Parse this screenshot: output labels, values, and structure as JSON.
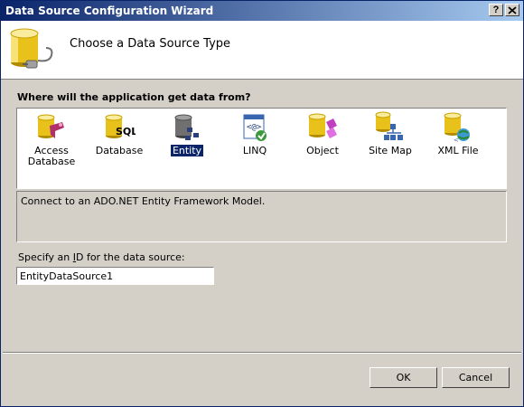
{
  "window": {
    "title": "Data Source Configuration Wizard",
    "help_label": "?",
    "close_label": "X"
  },
  "header": {
    "title": "Choose a Data Source Type",
    "icon": "database-plug-icon"
  },
  "source_prompt": "Where will the application get data from?",
  "source_types": [
    {
      "label": "Access\nDatabase",
      "icon": "access-database-icon"
    },
    {
      "label": "Database",
      "icon": "sql-database-icon"
    },
    {
      "label": "Entity",
      "icon": "entity-icon",
      "selected": true
    },
    {
      "label": "LINQ",
      "icon": "linq-icon"
    },
    {
      "label": "Object",
      "icon": "object-icon"
    },
    {
      "label": "Site Map",
      "icon": "site-map-icon"
    },
    {
      "label": "XML File",
      "icon": "xml-file-icon"
    }
  ],
  "description": "Connect to an ADO.NET Entity Framework Model.",
  "id_field": {
    "label_prefix": "Specify an ",
    "label_access": "I",
    "label_suffix": "D for the data source:",
    "value": "EntityDataSource1"
  },
  "buttons": {
    "ok": "OK",
    "cancel": "Cancel"
  }
}
